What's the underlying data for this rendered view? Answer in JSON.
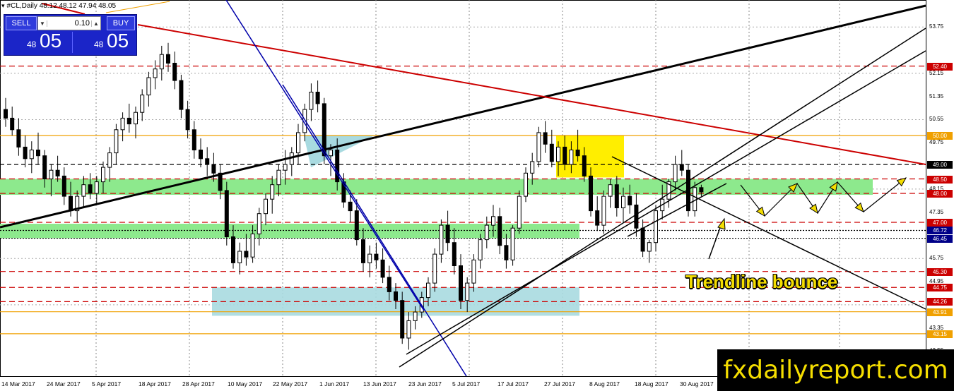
{
  "window": {
    "title": "#CL,Daily  48.12 48.12 47.94 48.05"
  },
  "trade_panel": {
    "sell_label": "SELL",
    "buy_label": "BUY",
    "lot_value": "0.10",
    "sell_small": "48",
    "sell_big": "05",
    "buy_small": "48",
    "buy_big": "05"
  },
  "price_axis": {
    "labels": [
      "53.75",
      "52.15",
      "51.35",
      "50.55",
      "49.75",
      "48.15",
      "47.35",
      "45.75",
      "44.95",
      "43.35",
      "42.55"
    ],
    "tags": [
      {
        "text": "52.40",
        "color": "#cc0000"
      },
      {
        "text": "50.00",
        "color": "#f0a000"
      },
      {
        "text": "49.00",
        "color": "#000000"
      },
      {
        "text": "48.50",
        "color": "#cc0000"
      },
      {
        "text": "48.00",
        "color": "#cc0000"
      },
      {
        "text": "47.00",
        "color": "#cc0000"
      },
      {
        "text": "46.72",
        "color": "#000088"
      },
      {
        "text": "46.45",
        "color": "#000088"
      },
      {
        "text": "45.30",
        "color": "#cc0000"
      },
      {
        "text": "44.75",
        "color": "#cc0000"
      },
      {
        "text": "44.26",
        "color": "#cc0000"
      },
      {
        "text": "43.91",
        "color": "#f0a000"
      },
      {
        "text": "43.15",
        "color": "#f0a000"
      }
    ]
  },
  "date_axis": {
    "labels": [
      "14 Mar 2017",
      "24 Mar 2017",
      "5 Apr 2017",
      "18 Apr 2017",
      "28 Apr 2017",
      "10 May 2017",
      "22 May 2017",
      "1 Jun 2017",
      "13 Jun 2017",
      "23 Jun 2017",
      "5 Jul 2017",
      "17 Jul 2017",
      "27 Jul 2017",
      "8 Aug 2017",
      "18 Aug 2017",
      "30 Aug 2017"
    ]
  },
  "annotation": "Trendline bounce",
  "watermark": "fxdailyreport.com",
  "colors": {
    "support_zone": "#8de98d",
    "demand_zone": "#a8dae0",
    "consolidation_zone": "#ffee00",
    "resistance_line": "#cc0000",
    "channel_line": "#0000aa",
    "trend_line": "#000000",
    "arrow_fill": "#f4dd00",
    "bull_candle": "#ffffff",
    "bear_candle": "#000000"
  },
  "chart_data": {
    "type": "candlestick",
    "symbol": "#CL",
    "timeframe": "Daily",
    "last_bar": {
      "open": 48.12,
      "high": 48.12,
      "low": 47.94,
      "close": 48.05
    },
    "horizontal_levels": [
      52.4,
      50.0,
      49.0,
      48.5,
      48.0,
      47.0,
      46.72,
      46.45,
      45.3,
      44.75,
      44.26,
      43.91,
      43.15
    ],
    "y_range": [
      42.2,
      54.4
    ],
    "grid": true
  }
}
